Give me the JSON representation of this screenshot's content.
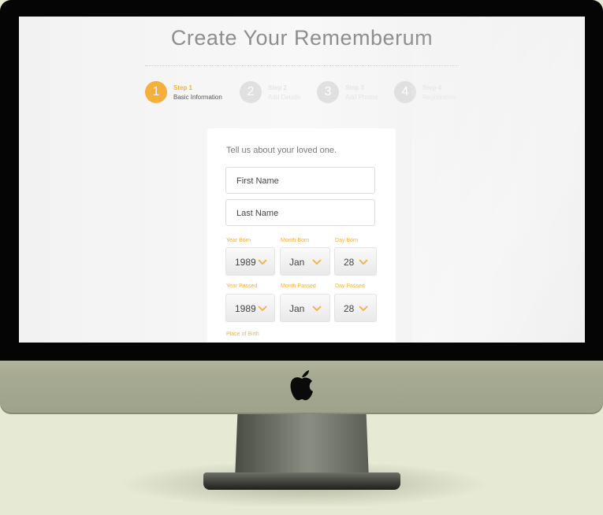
{
  "page": {
    "title": "Create Your Rememberum"
  },
  "steps": [
    {
      "number": "1",
      "step_label": "Step 1",
      "name": "Basic Information",
      "active": true
    },
    {
      "number": "2",
      "step_label": "Step 2",
      "name": "Add Details",
      "active": false
    },
    {
      "number": "3",
      "step_label": "Step 3",
      "name": "Add Photos",
      "active": false
    },
    {
      "number": "4",
      "step_label": "Step 4",
      "name": "Registration",
      "active": false
    }
  ],
  "form": {
    "intro": "Tell us about your loved one.",
    "first_name": {
      "placeholder": "First Name"
    },
    "last_name": {
      "placeholder": "Last Name"
    },
    "born": {
      "year": {
        "label": "Year Born",
        "value": "1989"
      },
      "month": {
        "label": "Month Born",
        "value": "Jan"
      },
      "day": {
        "label": "Day Born",
        "value": "28"
      }
    },
    "passed": {
      "year": {
        "label": "Year Passed",
        "value": "1989"
      },
      "month": {
        "label": "Month Passed",
        "value": "Jan"
      },
      "day": {
        "label": "Day Passed",
        "value": "28"
      }
    },
    "place_of_birth": {
      "label": "Place of Birth"
    }
  },
  "colors": {
    "accent": "#f6ae3c",
    "inactive": "#e0e0e0",
    "background": "#e6e9d3"
  },
  "icons": {
    "dropdown": "chevron-down-icon",
    "brand": "apple-logo-icon"
  }
}
